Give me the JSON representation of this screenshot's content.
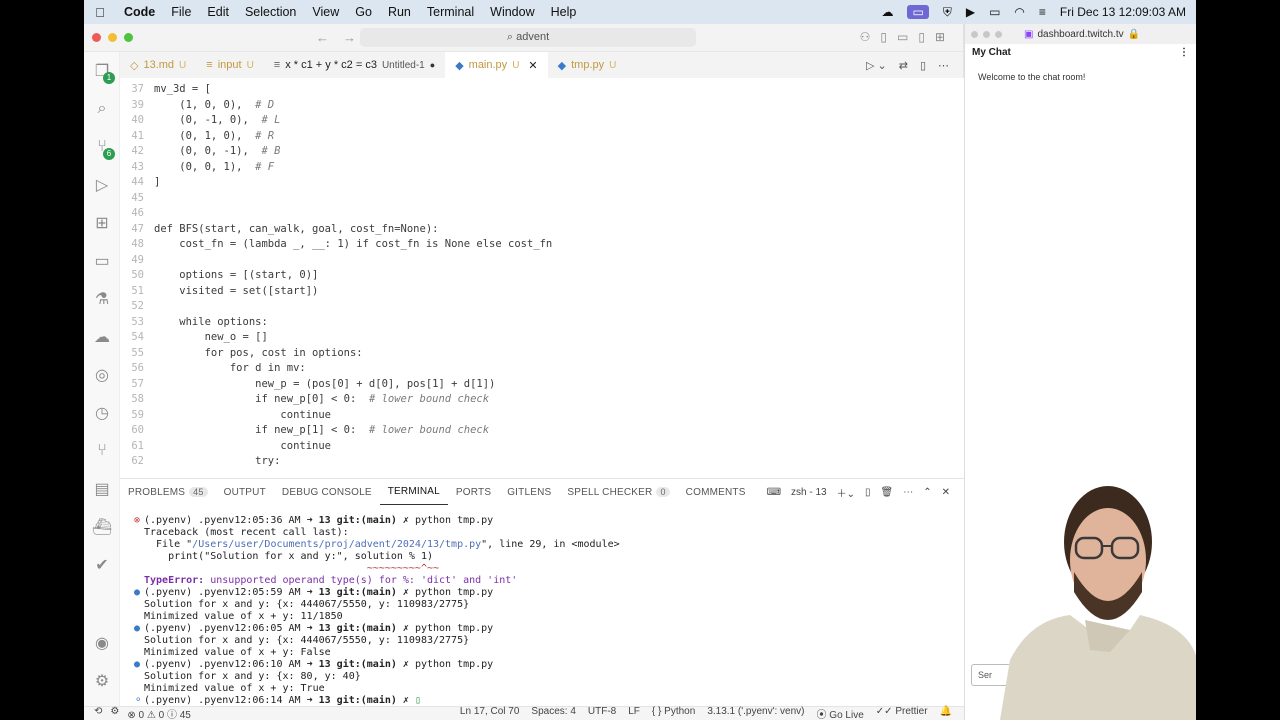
{
  "menubar": {
    "app": "Code",
    "items": [
      "File",
      "Edit",
      "Selection",
      "View",
      "Go",
      "Run",
      "Terminal",
      "Window",
      "Help"
    ],
    "clock": "Fri Dec 13  12:09:03 AM"
  },
  "titlebar": {
    "search": "advent"
  },
  "activity": {
    "badge1": "1",
    "badge2": "6"
  },
  "tabs": [
    {
      "label": "13.md",
      "status": "U"
    },
    {
      "label": "input",
      "status": "U"
    },
    {
      "label": "x * c1 + y * c2 = c3",
      "sub": "Untitled-1",
      "status": "●"
    },
    {
      "label": "main.py",
      "status": "U",
      "active": true
    },
    {
      "label": "tmp.py",
      "status": "U"
    }
  ],
  "code": [
    {
      "n": "37",
      "t": "mv_3d = ["
    },
    {
      "n": "39",
      "t": "    (1, 0, 0),  ",
      "c": "# D"
    },
    {
      "n": "40",
      "t": "    (0, -1, 0),  ",
      "c": "# L"
    },
    {
      "n": "41",
      "t": "    (0, 1, 0),  ",
      "c": "# R"
    },
    {
      "n": "42",
      "t": "    (0, 0, -1),  ",
      "c": "# B"
    },
    {
      "n": "43",
      "t": "    (0, 0, 1),  ",
      "c": "# F"
    },
    {
      "n": "44",
      "t": "]"
    },
    {
      "n": "45",
      "t": ""
    },
    {
      "n": "46",
      "t": ""
    },
    {
      "n": "47",
      "t": "def BFS(start, can_walk, goal, cost_fn=None):"
    },
    {
      "n": "48",
      "t": "    cost_fn = (lambda _, __: 1) if cost_fn is None else cost_fn"
    },
    {
      "n": "49",
      "t": ""
    },
    {
      "n": "50",
      "t": "    options = [(start, 0)]"
    },
    {
      "n": "51",
      "t": "    visited = set([start])"
    },
    {
      "n": "52",
      "t": ""
    },
    {
      "n": "53",
      "t": "    while options:"
    },
    {
      "n": "54",
      "t": "        new_o = []"
    },
    {
      "n": "55",
      "t": "        for pos, cost in options:"
    },
    {
      "n": "56",
      "t": "            for d in mv:"
    },
    {
      "n": "57",
      "t": "                new_p = (pos[0] + d[0], pos[1] + d[1])"
    },
    {
      "n": "58",
      "t": "                if new_p[0] < 0:  ",
      "c": "# lower bound check"
    },
    {
      "n": "59",
      "t": "                    continue"
    },
    {
      "n": "60",
      "t": "                if new_p[1] < 0:  ",
      "c": "# lower bound check"
    },
    {
      "n": "61",
      "t": "                    continue"
    },
    {
      "n": "62",
      "t": "                try:"
    }
  ],
  "panel": {
    "tabs": [
      "PROBLEMS",
      "OUTPUT",
      "DEBUG CONSOLE",
      "TERMINAL",
      "PORTS",
      "GITLENS",
      "SPELL CHECKER",
      "COMMENTS"
    ],
    "problems_count": "45",
    "spell_count": "0",
    "shell": "zsh - 13"
  },
  "terminal": [
    {
      "k": "prompt",
      "err": true,
      "time": "12:05:36 AM",
      "cmd": "python tmp.py"
    },
    {
      "k": "plain",
      "t": "Traceback (most recent call last):"
    },
    {
      "k": "file",
      "pre": "  File \"",
      "path": "/Users/user/Documents/proj/advent/2024/13/tmp.py",
      "post": "\", line 29, in <module>"
    },
    {
      "k": "plain",
      "t": "    print(\"Solution for x and y:\", solution % 1)"
    },
    {
      "k": "plain",
      "t": "                                     ~~~~~~~~~^~~"
    },
    {
      "k": "error",
      "name": "TypeError:",
      "msg": " unsupported operand type(s) for %: 'dict' and 'int'"
    },
    {
      "k": "prompt",
      "time": "12:05:59 AM",
      "cmd": "python tmp.py"
    },
    {
      "k": "plain",
      "t": "Solution for x and y: {x: 444067/5550, y: 110983/2775}"
    },
    {
      "k": "plain",
      "t": "Minimized value of x + y: 11/1850"
    },
    {
      "k": "prompt",
      "time": "12:06:05 AM",
      "cmd": "python tmp.py"
    },
    {
      "k": "plain",
      "t": "Solution for x and y: {x: 444067/5550, y: 110983/2775}"
    },
    {
      "k": "plain",
      "t": "Minimized value of x + y: False"
    },
    {
      "k": "prompt",
      "time": "12:06:10 AM",
      "cmd": "python tmp.py"
    },
    {
      "k": "plain",
      "t": "Solution for x and y: {x: 80, y: 40}"
    },
    {
      "k": "plain",
      "t": "Minimized value of x + y: True"
    },
    {
      "k": "prompt",
      "time": "12:06:14 AM",
      "cmd": ""
    }
  ],
  "prompt_parts": {
    "env": "(.pyenv) .pyenv",
    "arrow": " ➜ ",
    "dir": "13 git:(main) ✗ "
  },
  "status": {
    "errors": "0",
    "warnings": "0",
    "info": "45",
    "position": "Ln 17, Col 70",
    "spaces": "Spaces: 4",
    "encoding": "UTF-8",
    "eol": "LF",
    "language": "Python",
    "interpreter": "3.13.1 ('.pyenv': venv)",
    "golive": "Go Live",
    "prettier": "Prettier"
  },
  "browser": {
    "url": "dashboard.twitch.tv",
    "chat_title": "My Chat",
    "welcome": "Welcome to the chat room!",
    "input_placeholder": "Ser"
  }
}
